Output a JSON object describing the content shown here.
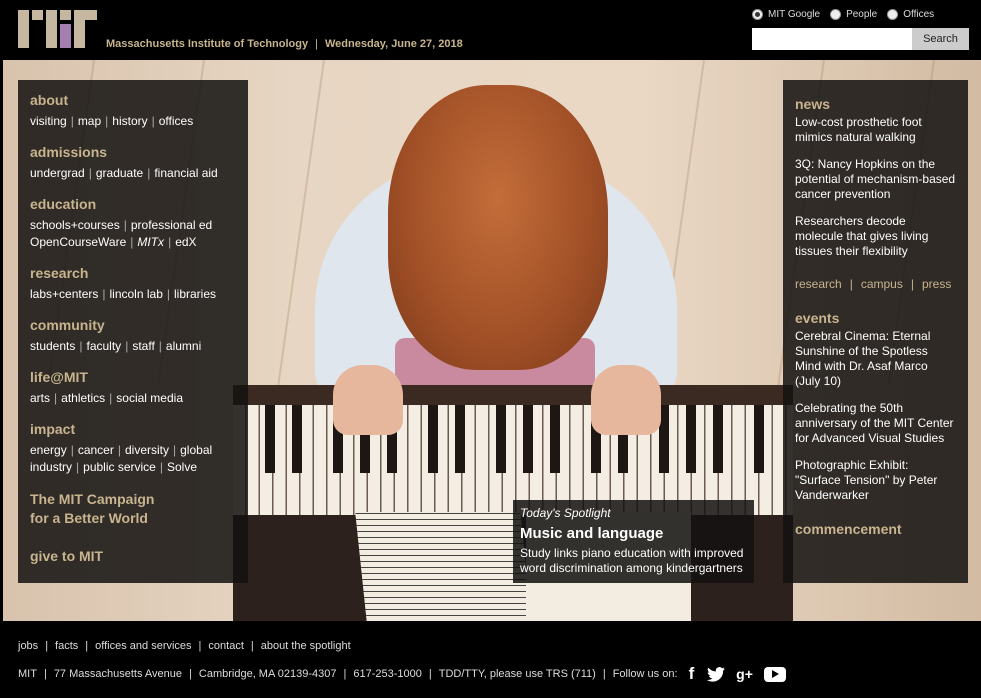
{
  "header": {
    "institute_name": "Massachusetts Institute of Technology",
    "separator": "|",
    "date": "Wednesday, June 27, 2018"
  },
  "search": {
    "options": [
      {
        "label": "MIT Google",
        "selected": true
      },
      {
        "label": "People",
        "selected": false
      },
      {
        "label": "Offices",
        "selected": false
      }
    ],
    "placeholder": "",
    "button_label": "Search"
  },
  "left_nav": {
    "about": {
      "title": "about",
      "links": [
        "visiting",
        "map",
        "history",
        "offices"
      ]
    },
    "admissions": {
      "title": "admissions",
      "links": [
        "undergrad",
        "graduate",
        "financial aid"
      ]
    },
    "education": {
      "title": "education",
      "row1": [
        "schools+courses",
        "professional ed"
      ],
      "row2": [
        "OpenCourseWare",
        "MITx",
        "edX"
      ]
    },
    "research": {
      "title": "research",
      "links": [
        "labs+centers",
        "lincoln lab",
        "libraries"
      ]
    },
    "community": {
      "title": "community",
      "links": [
        "students",
        "faculty",
        "staff",
        "alumni"
      ]
    },
    "life": {
      "title": "life@MIT",
      "links": [
        "arts",
        "athletics",
        "social media"
      ]
    },
    "impact": {
      "title": "impact",
      "row1": [
        "energy",
        "cancer",
        "diversity",
        "global"
      ],
      "row2": [
        "industry",
        "public service",
        "Solve"
      ]
    },
    "campaign_line1": "The MIT Campaign",
    "campaign_line2": "for a Better World",
    "give": "give to MIT"
  },
  "right_panel": {
    "news_title": "news",
    "news": [
      "Low-cost prosthetic foot mimics natural walking",
      "3Q: Nancy Hopkins on the potential of mechanism-based cancer prevention",
      "Researchers decode molecule that gives living tissues their flexibility"
    ],
    "news_links": [
      "research",
      "campus",
      "press"
    ],
    "events_title": "events",
    "events": [
      "Cerebral Cinema: Eternal Sunshine of the Spotless Mind with Dr. Asaf Marco (July 10)",
      "Celebrating the 50th anniversary of the MIT Center for Advanced Visual Studies",
      "Photographic Exhibit: \"Surface Tension\" by Peter Vanderwarker"
    ],
    "commencement": "commencement"
  },
  "spotlight": {
    "kicker": "Today's Spotlight",
    "title": "Music and language",
    "description": "Study links piano education with improved word discrimination among kindergartners"
  },
  "footer": {
    "nav": [
      "jobs",
      "facts",
      "offices and services",
      "contact",
      "about the spotlight"
    ],
    "info": [
      "MIT",
      "77 Massachusetts Avenue",
      "Cambridge, MA 02139-4307",
      "617-253-1000",
      "TDD/TTY, please use TRS (711)"
    ],
    "follow": "Follow us on:",
    "social_icons": [
      "facebook-icon",
      "twitter-icon",
      "google-plus-icon",
      "youtube-icon"
    ]
  },
  "colors": {
    "accent": "#c8b48e",
    "logo_bar": "#c6b7a0",
    "logo_accent": "#a57fb0",
    "panel": "#141210"
  }
}
